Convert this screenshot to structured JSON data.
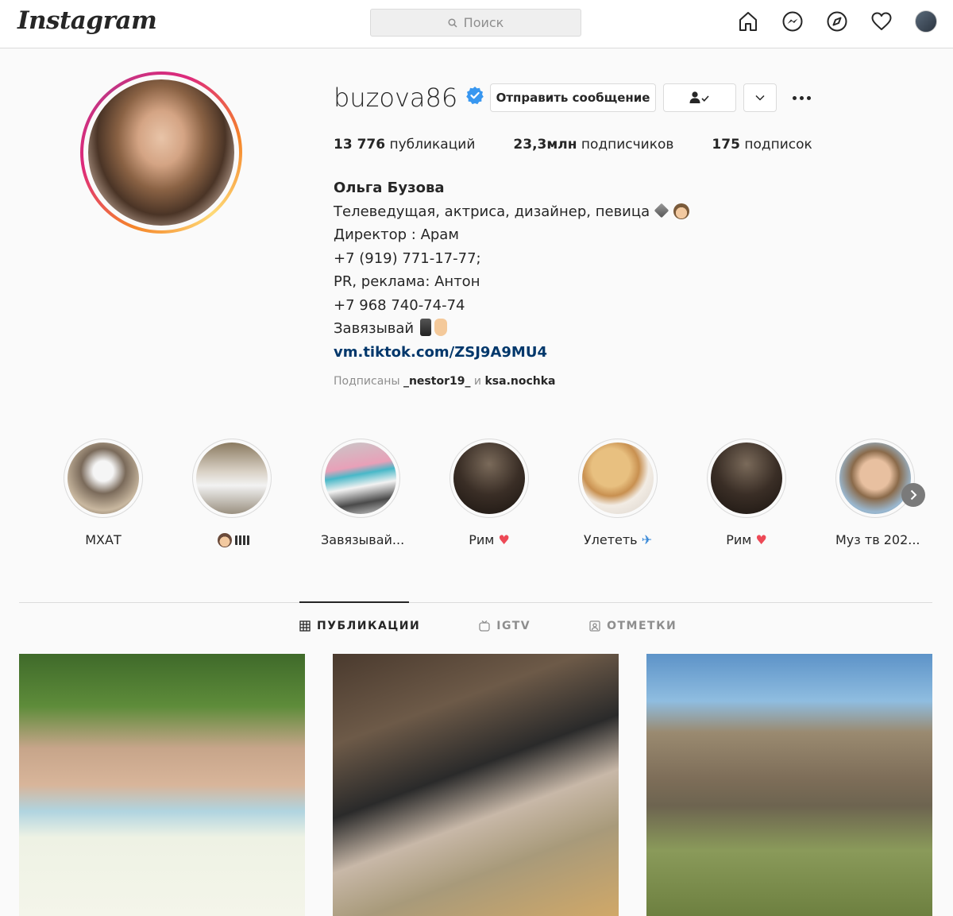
{
  "nav": {
    "logo": "Instagram",
    "search_placeholder": "Поиск",
    "icons": [
      "home-icon",
      "messenger-icon",
      "explore-icon",
      "heart-icon",
      "profile-avatar"
    ]
  },
  "profile": {
    "username": "buzova86",
    "verified": true,
    "message_button": "Отправить сообщение",
    "stats": {
      "posts_count": "13 776",
      "posts_label": "публикаций",
      "followers_count": "23,3млн",
      "followers_label": "подписчиков",
      "following_count": "175",
      "following_label": "подписок"
    },
    "bio": {
      "name": "Ольга Бузова",
      "line1": "Телеведущая, актриса, дизайнер, певица",
      "line2": "Директор : Арам",
      "line3": "+7 (919) 771-17-77;",
      "line4": "PR, реклама: Антон",
      "line5": "+7 968 740-74-74",
      "line6": "Завязывай",
      "link": "vm.tiktok.com/ZSJ9A9MU4"
    },
    "followed_by": {
      "prefix": "Подписаны",
      "user1": "_nestor19_",
      "conj": "и",
      "user2": "ksa.nochka"
    }
  },
  "highlights": [
    {
      "label": "МХАТ",
      "suffix": ""
    },
    {
      "label": "",
      "suffix": ""
    },
    {
      "label": "Завязывай...",
      "suffix": ""
    },
    {
      "label": "Рим",
      "suffix": "♥"
    },
    {
      "label": "Улететь",
      "suffix": "✈"
    },
    {
      "label": "Рим",
      "suffix": "♥"
    },
    {
      "label": "Муз тв 202...",
      "suffix": ""
    }
  ],
  "tabs": [
    {
      "label": "ПУБЛИКАЦИИ",
      "active": true
    },
    {
      "label": "IGTV",
      "active": false
    },
    {
      "label": "ОТМЕТКИ",
      "active": false
    }
  ],
  "colors": {
    "link": "#00376b",
    "verified": "#3897f0",
    "heart": "#ed4956",
    "text": "#262626",
    "muted": "#8e8e8e"
  }
}
